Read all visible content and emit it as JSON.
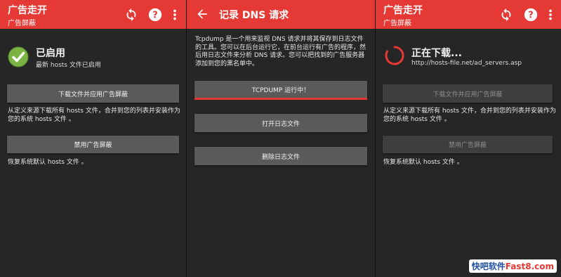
{
  "panel1": {
    "title": "广告走开",
    "subtitle": "广告屏蔽",
    "status_title": "已启用",
    "status_sub": "最新 hosts 文件已启用",
    "download_button": "下载文件并应用广告屏蔽",
    "download_desc": "从定义来源下载所有 hosts 文件，合并到您的列表并安装作为您的系统 hosts 文件 。",
    "disable_button": "禁用广告屏蔽",
    "disable_desc": "恢复系统默认 hosts 文件 。",
    "icons": [
      "refresh-icon",
      "help-icon",
      "overflow-menu-icon"
    ],
    "accent_color": "#e53935"
  },
  "panel2": {
    "title": "记录 DNS 请求",
    "intro": "Tcpdump 是一个用来监视 DNS 请求并将其保存到日志文件的工具。您可以在后台运行它，在前台运行有广告的程序，然后用日志文件来分析 DNS 请求。您可以把找到的广告服务器添加到您的黑名单中。",
    "tcpdump_button": "TCPDUMP 运行中！",
    "open_log_button": "打开日志文件",
    "delete_log_button": "删除日志文件"
  },
  "panel3": {
    "title": "广告走开",
    "subtitle": "广告屏蔽",
    "status_title": "正在下载...",
    "status_sub": "http://hosts-file.net/ad_servers.asp",
    "download_button": "下载文件并应用广告屏蔽",
    "download_desc": "从定义来源下载所有 hosts 文件，合并到您的列表并安装作为您的系统 hosts 文件 。",
    "disable_button": "禁用广告屏蔽",
    "disable_desc": "恢复系统默认 hosts 文件 。"
  },
  "watermark": {
    "part1": "快吧软件",
    "part2": "Fast8.com"
  }
}
